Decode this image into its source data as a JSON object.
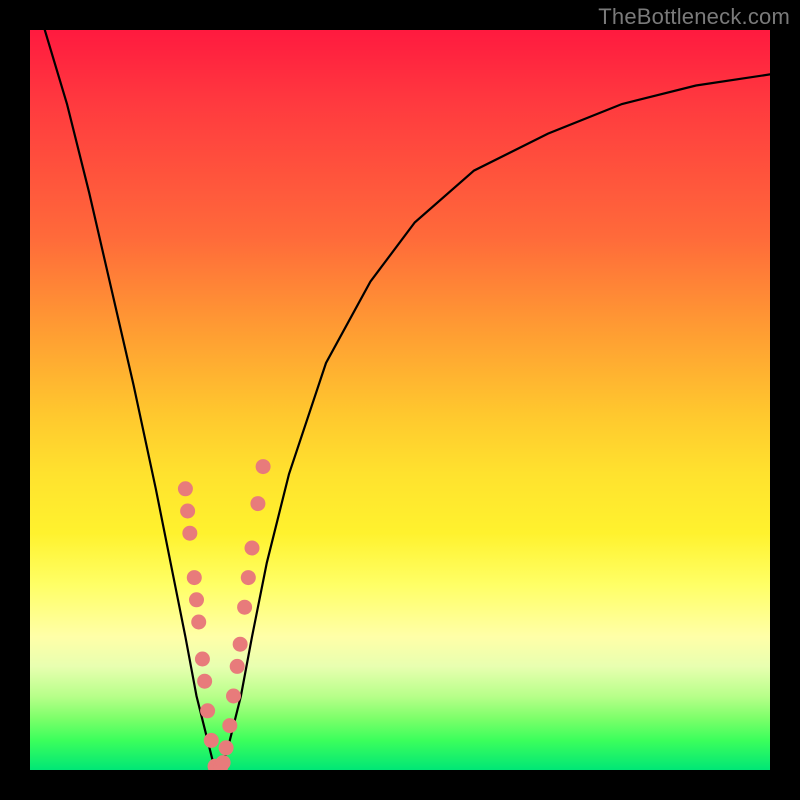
{
  "watermark": {
    "text": "TheBottleneck.com"
  },
  "chart_data": {
    "type": "line",
    "title": "",
    "xlabel": "",
    "ylabel": "",
    "xlim": [
      0,
      100
    ],
    "ylim": [
      0,
      100
    ],
    "grid": false,
    "legend": false,
    "series": [
      {
        "name": "bottleneck-curve",
        "x": [
          2,
          5,
          8,
          11,
          14,
          17,
          19,
          21,
          22.5,
          24,
          25,
          25.8,
          27,
          28.5,
          30,
          32,
          35,
          40,
          46,
          52,
          60,
          70,
          80,
          90,
          100
        ],
        "y": [
          100,
          90,
          78,
          65,
          52,
          38,
          28,
          18,
          10,
          4,
          0,
          0,
          4,
          10,
          18,
          28,
          40,
          55,
          66,
          74,
          81,
          86,
          90,
          92.5,
          94
        ]
      }
    ],
    "markers": [
      {
        "name": "left-branch-dots",
        "color": "#e87b7b",
        "points": [
          {
            "x": 21.0,
            "y": 38
          },
          {
            "x": 21.3,
            "y": 35
          },
          {
            "x": 21.6,
            "y": 32
          },
          {
            "x": 22.2,
            "y": 26
          },
          {
            "x": 22.5,
            "y": 23
          },
          {
            "x": 22.8,
            "y": 20
          },
          {
            "x": 23.3,
            "y": 15
          },
          {
            "x": 23.6,
            "y": 12
          },
          {
            "x": 24.0,
            "y": 8
          },
          {
            "x": 24.5,
            "y": 4
          }
        ]
      },
      {
        "name": "right-branch-dots",
        "color": "#e87b7b",
        "points": [
          {
            "x": 26.5,
            "y": 3
          },
          {
            "x": 27.0,
            "y": 6
          },
          {
            "x": 27.5,
            "y": 10
          },
          {
            "x": 28.0,
            "y": 14
          },
          {
            "x": 28.4,
            "y": 17
          },
          {
            "x": 29.0,
            "y": 22
          },
          {
            "x": 29.5,
            "y": 26
          },
          {
            "x": 30.0,
            "y": 30
          },
          {
            "x": 30.8,
            "y": 36
          },
          {
            "x": 31.5,
            "y": 41
          }
        ]
      },
      {
        "name": "bottom-dots",
        "color": "#e87b7b",
        "points": [
          {
            "x": 25.0,
            "y": 0.5
          },
          {
            "x": 25.4,
            "y": 0.4
          },
          {
            "x": 25.8,
            "y": 0.5
          },
          {
            "x": 26.1,
            "y": 1.0
          }
        ]
      }
    ]
  }
}
